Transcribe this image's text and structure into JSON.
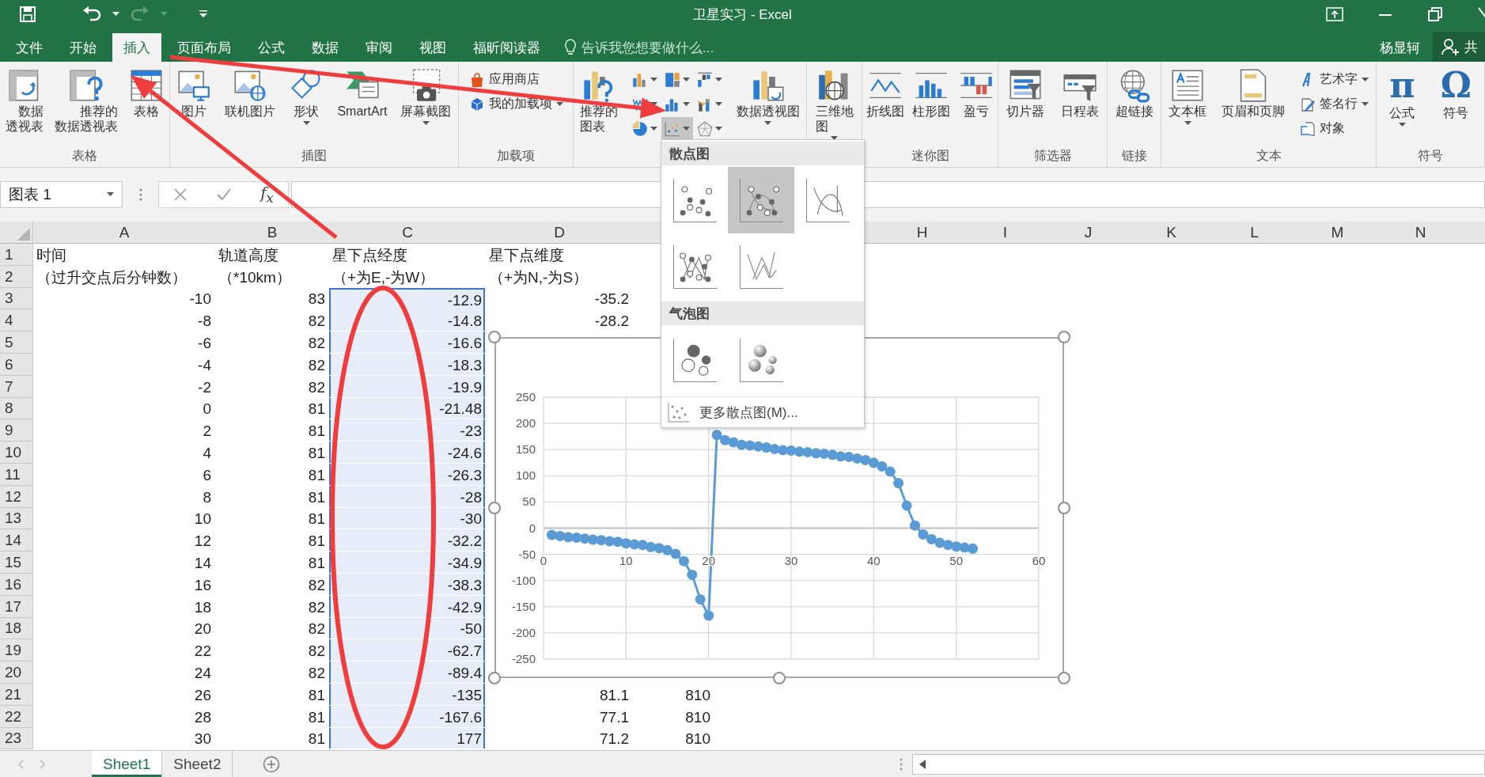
{
  "window": {
    "title": "卫星实习 - Excel"
  },
  "ribbon_tabs": [
    {
      "label": "文件",
      "selected": false
    },
    {
      "label": "开始",
      "selected": false
    },
    {
      "label": "插入",
      "selected": true
    },
    {
      "label": "页面布局",
      "selected": false
    },
    {
      "label": "公式",
      "selected": false
    },
    {
      "label": "数据",
      "selected": false
    },
    {
      "label": "审阅",
      "selected": false
    },
    {
      "label": "视图",
      "selected": false
    },
    {
      "label": "福昕阅读器",
      "selected": false
    }
  ],
  "tell_me": {
    "placeholder": "告诉我您想要做什么..."
  },
  "user": {
    "name": "杨显轲"
  },
  "share_button": {
    "label": "共"
  },
  "ribbon": {
    "groups": [
      {
        "label": "表格",
        "buttons": [
          {
            "kind": "large",
            "label": "数据透视表"
          },
          {
            "kind": "large",
            "label": "推荐的数据透视表"
          },
          {
            "kind": "large",
            "label": "表格"
          }
        ]
      },
      {
        "label": "插图",
        "buttons": [
          {
            "kind": "large",
            "label": "图片"
          },
          {
            "kind": "large",
            "label": "联机图片"
          },
          {
            "kind": "large",
            "label": "形状",
            "menu": true
          },
          {
            "kind": "large",
            "label": "SmartArt"
          },
          {
            "kind": "large",
            "label": "屏幕截图",
            "menu": true
          }
        ]
      },
      {
        "label": "加载项",
        "buttons": [
          {
            "kind": "small_stack",
            "items": [
              {
                "label": "应用商店"
              },
              {
                "label": "我的加载项",
                "menu": true
              }
            ]
          }
        ]
      },
      {
        "buttons": [
          {
            "kind": "large",
            "label": "推荐的图表"
          },
          {
            "kind": "chart_grid",
            "items": [
              {
                "expanded": false
              },
              {
                "expanded": false
              },
              {
                "expanded": false
              },
              {
                "expanded": false
              },
              {
                "expanded": false
              },
              {
                "expanded": false
              },
              {
                "expanded": false
              },
              {
                "expanded": true
              },
              {
                "expanded": false
              }
            ]
          },
          {
            "kind": "large",
            "label": "数据透视图",
            "menu": true
          }
        ]
      },
      {
        "buttons": [
          {
            "kind": "large",
            "label": "三维地图",
            "menu": true
          }
        ]
      },
      {
        "label": "迷你图",
        "buttons": [
          {
            "kind": "large",
            "label": "折线图"
          },
          {
            "kind": "large",
            "label": "柱形图"
          },
          {
            "kind": "large",
            "label": "盈亏"
          }
        ]
      },
      {
        "label": "筛选器",
        "buttons": [
          {
            "kind": "large",
            "label": "切片器"
          },
          {
            "kind": "large",
            "label": "日程表"
          }
        ]
      },
      {
        "label": "链接",
        "buttons": [
          {
            "kind": "large",
            "label": "超链接"
          }
        ]
      },
      {
        "label": "文本",
        "buttons": [
          {
            "kind": "large",
            "label": "文本框",
            "menu": true
          },
          {
            "kind": "large",
            "label": "页眉和页脚"
          },
          {
            "kind": "small_stack",
            "items": [
              {
                "label": "艺术字",
                "menu": true
              },
              {
                "label": "签名行",
                "menu": true
              },
              {
                "label": "对象"
              }
            ]
          }
        ]
      },
      {
        "label": "符号",
        "buttons": [
          {
            "kind": "glyph",
            "glyph": "π",
            "label": "公式",
            "menu": true
          },
          {
            "kind": "glyph",
            "glyph": "Ω",
            "label": "符号"
          }
        ]
      }
    ]
  },
  "formula_bar": {
    "name_box": "图表 1",
    "function_label": "f$_{x}$"
  },
  "sheet": {
    "column_headers_left": [
      "A",
      "B",
      "C",
      "D"
    ],
    "column_headers_right": [
      "H",
      "I",
      "J",
      "K",
      "L",
      "M",
      "N"
    ],
    "rows": [
      {
        "number": "1",
        "cells": [
          {
            "text": "时间",
            "selected": false
          },
          {
            "text": "轨道高度",
            "selected": false
          },
          {
            "text": "星下点经度",
            "selected": false
          },
          {
            "text": "星下点维度",
            "selected": false
          }
        ]
      },
      {
        "number": "2",
        "cells": [
          {
            "text": "（过升交点后分钟数）",
            "selected": false
          },
          {
            "text": "（*10km）",
            "selected": false
          },
          {
            "text": "（+为E,-为W）",
            "selected": false
          },
          {
            "text": "（+为N,-为S）",
            "selected": false
          }
        ]
      },
      {
        "number": "3",
        "cells": [
          {
            "text": "-10",
            "selected": false
          },
          {
            "text": "83",
            "selected": false
          },
          {
            "text": "-12.9",
            "selected": true
          },
          {
            "text": "-35.2",
            "selected": false
          }
        ]
      },
      {
        "number": "4",
        "cells": [
          {
            "text": "-8",
            "selected": false
          },
          {
            "text": "82",
            "selected": false
          },
          {
            "text": "-14.8",
            "selected": true
          },
          {
            "text": "-28.2",
            "selected": false
          }
        ]
      },
      {
        "number": "5",
        "cells": [
          {
            "text": "-6",
            "selected": false
          },
          {
            "text": "82",
            "selected": false
          },
          {
            "text": "-16.6",
            "selected": true
          }
        ]
      },
      {
        "number": "6",
        "cells": [
          {
            "text": "-4",
            "selected": false
          },
          {
            "text": "82",
            "selected": false
          },
          {
            "text": "-18.3",
            "selected": true
          }
        ]
      },
      {
        "number": "7",
        "cells": [
          {
            "text": "-2",
            "selected": false
          },
          {
            "text": "82",
            "selected": false
          },
          {
            "text": "-19.9",
            "selected": true
          }
        ]
      },
      {
        "number": "8",
        "cells": [
          {
            "text": "0",
            "selected": false
          },
          {
            "text": "81",
            "selected": false
          },
          {
            "text": "-21.48",
            "selected": true
          }
        ]
      },
      {
        "number": "9",
        "cells": [
          {
            "text": "2",
            "selected": false
          },
          {
            "text": "81",
            "selected": false
          },
          {
            "text": "-23",
            "selected": true
          }
        ]
      },
      {
        "number": "10",
        "cells": [
          {
            "text": "4",
            "selected": false
          },
          {
            "text": "81",
            "selected": false
          },
          {
            "text": "-24.6",
            "selected": true
          }
        ]
      },
      {
        "number": "11",
        "cells": [
          {
            "text": "6",
            "selected": false
          },
          {
            "text": "81",
            "selected": false
          },
          {
            "text": "-26.3",
            "selected": true
          }
        ]
      },
      {
        "number": "12",
        "cells": [
          {
            "text": "8",
            "selected": false
          },
          {
            "text": "81",
            "selected": false
          },
          {
            "text": "-28",
            "selected": true
          }
        ]
      },
      {
        "number": "13",
        "cells": [
          {
            "text": "10",
            "selected": false
          },
          {
            "text": "81",
            "selected": false
          },
          {
            "text": "-30",
            "selected": true
          }
        ]
      },
      {
        "number": "14",
        "cells": [
          {
            "text": "12",
            "selected": false
          },
          {
            "text": "81",
            "selected": false
          },
          {
            "text": "-32.2",
            "selected": true
          }
        ]
      },
      {
        "number": "15",
        "cells": [
          {
            "text": "14",
            "selected": false
          },
          {
            "text": "81",
            "selected": false
          },
          {
            "text": "-34.9",
            "selected": true
          }
        ]
      },
      {
        "number": "16",
        "cells": [
          {
            "text": "16",
            "selected": false
          },
          {
            "text": "82",
            "selected": false
          },
          {
            "text": "-38.3",
            "selected": true
          }
        ]
      },
      {
        "number": "17",
        "cells": [
          {
            "text": "18",
            "selected": false
          },
          {
            "text": "82",
            "selected": false
          },
          {
            "text": "-42.9",
            "selected": true
          }
        ]
      },
      {
        "number": "18",
        "cells": [
          {
            "text": "20",
            "selected": false
          },
          {
            "text": "82",
            "selected": false
          },
          {
            "text": "-50",
            "selected": true
          }
        ]
      },
      {
        "number": "19",
        "cells": [
          {
            "text": "22",
            "selected": false
          },
          {
            "text": "82",
            "selected": false
          },
          {
            "text": "-62.7",
            "selected": true
          }
        ]
      },
      {
        "number": "20",
        "cells": [
          {
            "text": "24",
            "selected": false
          },
          {
            "text": "82",
            "selected": false
          },
          {
            "text": "-89.4",
            "selected": true
          }
        ]
      },
      {
        "number": "21",
        "cells": [
          {
            "text": "26",
            "selected": false
          },
          {
            "text": "81",
            "selected": false
          },
          {
            "text": "-135",
            "selected": true
          },
          {
            "text": "81.1",
            "selected": false
          },
          {
            "text": "810",
            "selected": false
          }
        ]
      },
      {
        "number": "22",
        "cells": [
          {
            "text": "28",
            "selected": false
          },
          {
            "text": "81",
            "selected": false
          },
          {
            "text": "-167.6",
            "selected": true
          },
          {
            "text": "77.1",
            "selected": false
          },
          {
            "text": "810",
            "selected": false
          }
        ]
      },
      {
        "number": "23",
        "cells": [
          {
            "text": "30",
            "selected": false
          },
          {
            "text": "81",
            "selected": false
          },
          {
            "text": "177",
            "selected": true
          },
          {
            "text": "71.2",
            "selected": false
          },
          {
            "text": "810",
            "selected": false
          }
        ]
      }
    ],
    "chart": {
      "chart_data": {
        "type": "line",
        "grid": true,
        "x": [
          1,
          2,
          3,
          4,
          5,
          6,
          7,
          8,
          9,
          10,
          11,
          12,
          13,
          14,
          15,
          16,
          17,
          18,
          19,
          20,
          21,
          22,
          23,
          24,
          25,
          26,
          27,
          28,
          29,
          30,
          31,
          32,
          33,
          34,
          35,
          36,
          37,
          38,
          39,
          40,
          41,
          42,
          43,
          44,
          45,
          46,
          47,
          48,
          49,
          50,
          51,
          52
        ],
        "series": [
          {
            "color": "#5b9bd5",
            "marker": true,
            "values": [
              -13,
              -15,
              -17,
              -18,
              -20,
              -22,
              -23,
              -25,
              -26,
              -29,
              -31,
              -32,
              -36,
              -38,
              -42,
              -49,
              -63,
              -89,
              -136,
              -167,
              178,
              168,
              164,
              159,
              158,
              156,
              154,
              151,
              149,
              148,
              146,
              145,
              143,
              142,
              140,
              137,
              136,
              133,
              130,
              125,
              118,
              108,
              86,
              43,
              5,
              -12,
              -21,
              -28,
              -32,
              -35,
              -37,
              -39
            ]
          }
        ],
        "xlim": [
          0,
          60
        ],
        "ylim": [
          -250,
          250
        ],
        "xticks": [
          0,
          10,
          20,
          30,
          40,
          50,
          60
        ],
        "yticks": [
          -250,
          -200,
          -150,
          -100,
          -50,
          0,
          50,
          100,
          150,
          200,
          250
        ]
      }
    }
  },
  "scatter_menu": {
    "sections": [
      {
        "title": "散点图",
        "options": [
          {
            "selected": false
          },
          {
            "selected": true
          },
          {
            "selected": false
          },
          {
            "selected": false
          },
          {
            "selected": false
          }
        ]
      },
      {
        "title": "气泡图",
        "options": [
          {
            "selected": false
          },
          {
            "selected": false
          }
        ]
      }
    ],
    "more": {
      "label": "更多散点图(M)..."
    }
  },
  "sheet_tabs": [
    {
      "label": "Sheet1",
      "selected": true
    },
    {
      "label": "Sheet2",
      "selected": false
    }
  ]
}
